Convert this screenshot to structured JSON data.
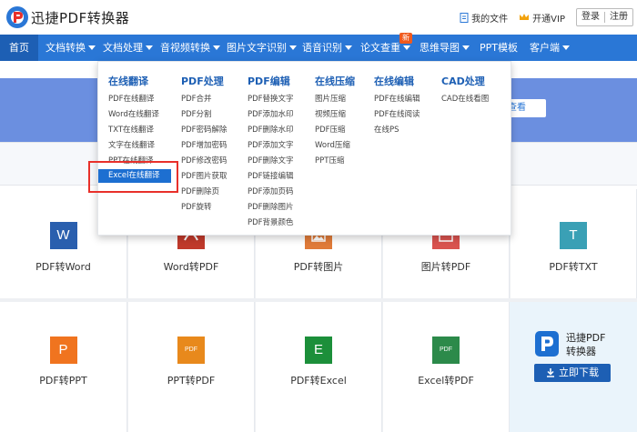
{
  "header": {
    "brand": "迅捷PDF转换器",
    "my_files": "我的文件",
    "vip": "开通VIP",
    "login": "登录",
    "register": "注册"
  },
  "nav": {
    "items": [
      {
        "label": "首页"
      },
      {
        "label": "文档转换"
      },
      {
        "label": "文档处理"
      },
      {
        "label": "音视频转换"
      },
      {
        "label": "图片文字识别"
      },
      {
        "label": "语音识别"
      },
      {
        "label": "论文查重"
      },
      {
        "label": "思维导图"
      },
      {
        "label": "PPT模板"
      },
      {
        "label": "客户端"
      }
    ],
    "new_badge": "新"
  },
  "banner": {
    "button_label": "查看"
  },
  "dropdown": {
    "columns": [
      {
        "title": "在线翻译",
        "items": [
          "PDF在线翻译",
          "Word在线翻译",
          "TXT在线翻译",
          "文字在线翻译",
          "PPT在线翻译",
          "Excel在线翻译"
        ]
      },
      {
        "title": "PDF处理",
        "items": [
          "PDF合并",
          "PDF分割",
          "PDF密码解除",
          "PDF增加密码",
          "PDF修改密码",
          "PDF图片获取",
          "PDF删除页",
          "PDF旋转"
        ]
      },
      {
        "title": "PDF编辑",
        "items": [
          "PDF替换文字",
          "PDF添加水印",
          "PDF删除水印",
          "PDF添加文字",
          "PDF删除文字",
          "PDF链接编辑",
          "PDF添加页码",
          "PDF删除图片",
          "PDF背景颜色"
        ]
      },
      {
        "title": "在线压缩",
        "items": [
          "图片压缩",
          "视频压缩",
          "PDF压缩",
          "Word压缩",
          "PPT压缩"
        ]
      },
      {
        "title": "在线编辑",
        "items": [
          "PDF在线编辑",
          "PDF在线阅读",
          "在线PS"
        ]
      },
      {
        "title": "CAD处理",
        "items": [
          "CAD在线看图"
        ]
      }
    ]
  },
  "tools": [
    {
      "label": "PDF转Word",
      "glyph": "W",
      "color": "#2a5fae",
      "icon": "word-file-icon"
    },
    {
      "label": "Word转PDF",
      "glyph": "",
      "color": "#c0392b",
      "icon": "pdf-file-icon"
    },
    {
      "label": "PDF转图片",
      "glyph": "",
      "color": "#e07b39",
      "icon": "image-file-icon"
    },
    {
      "label": "图片转PDF",
      "glyph": "",
      "color": "#d9534f",
      "icon": "image-to-pdf-icon"
    },
    {
      "label": "PDF转TXT",
      "glyph": "T",
      "color": "#3aa0b5",
      "icon": "txt-file-icon"
    },
    {
      "label": "PDF转PPT",
      "glyph": "P",
      "color": "#f0741f",
      "icon": "ppt-file-icon"
    },
    {
      "label": "PPT转PDF",
      "glyph": "PDF",
      "color": "#e8891c",
      "icon": "ppt-to-pdf-icon"
    },
    {
      "label": "PDF转Excel",
      "glyph": "E",
      "color": "#1c8f3a",
      "icon": "excel-file-icon"
    },
    {
      "label": "Excel转PDF",
      "glyph": "PDF",
      "color": "#2c8a4a",
      "icon": "excel-to-pdf-icon"
    }
  ],
  "download": {
    "app_name_1": "迅捷PDF",
    "app_name_2": "转换器",
    "button": "立即下载"
  },
  "colors": {
    "nav_bg": "#2a77d6",
    "accent": "#1d5fb4",
    "highlight": "#e8302a"
  }
}
